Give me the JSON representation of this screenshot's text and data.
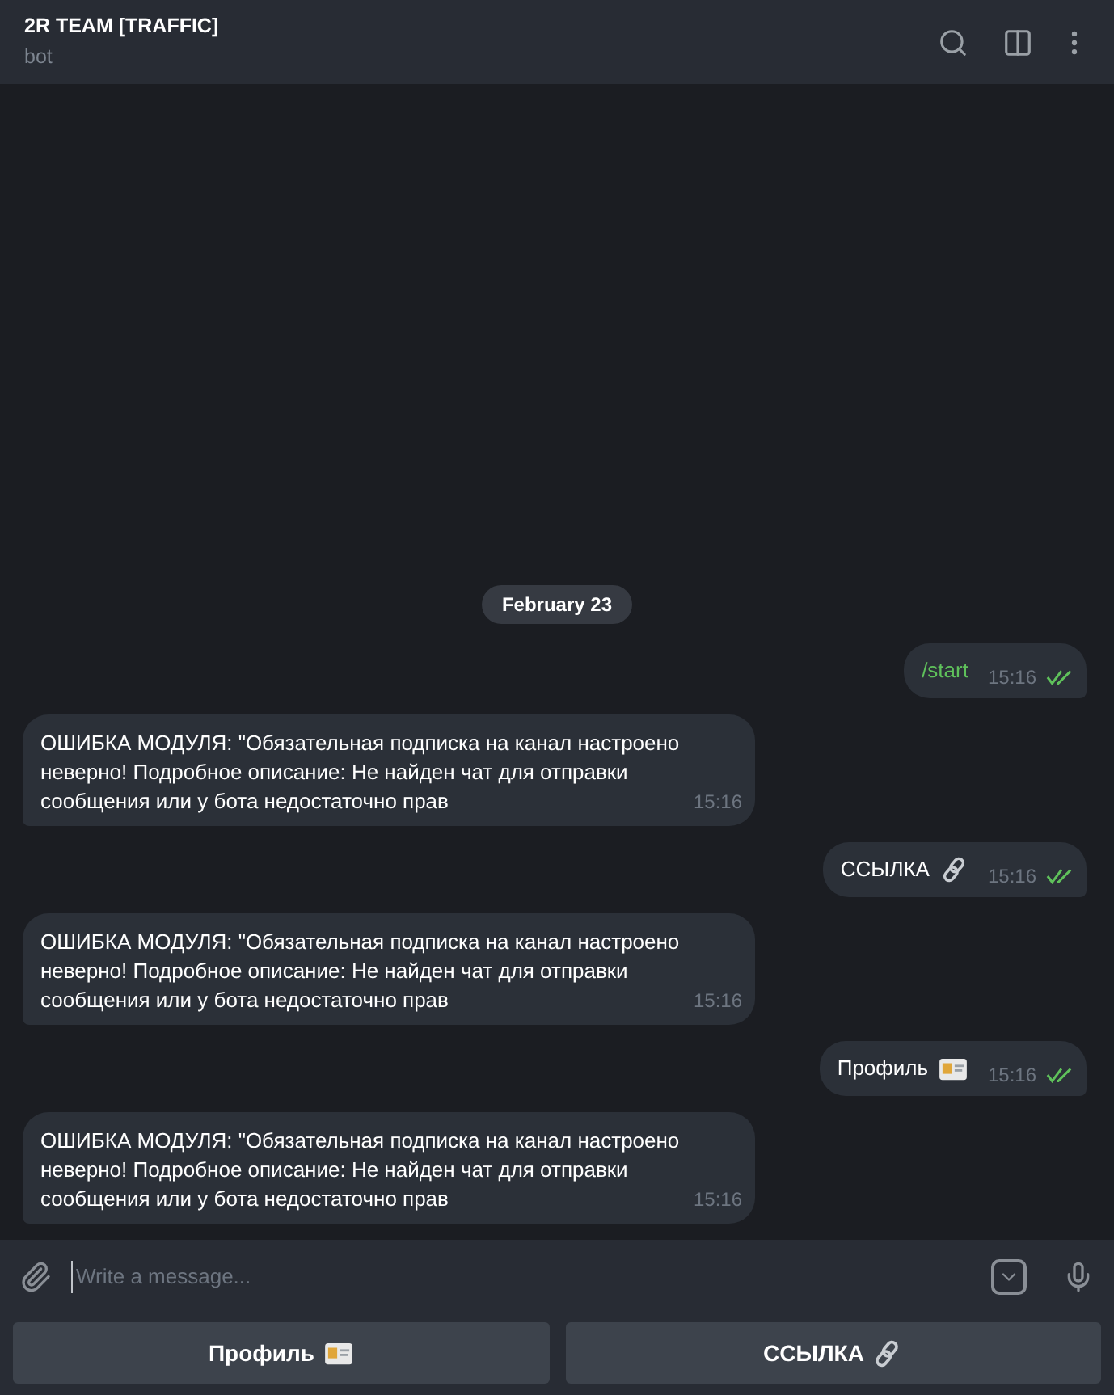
{
  "header": {
    "title": "2R TEAM [TRAFFIC]",
    "subtitle": "bot"
  },
  "date_badge": "February 23",
  "messages": [
    {
      "kind": "command",
      "text": "/start",
      "time": "15:16",
      "read": true
    },
    {
      "kind": "incoming",
      "text": "ОШИБКА МОДУЛЯ: \"Обязательная подписка на канал настроено неверно! Подробное описание: Не найден чат для отправки сообщения или у бота недостаточно прав",
      "time": "15:16"
    },
    {
      "kind": "link",
      "text": "ССЫЛКА",
      "time": "15:16",
      "read": true
    },
    {
      "kind": "incoming",
      "text": "ОШИБКА МОДУЛЯ: \"Обязательная подписка на канал настроено неверно! Подробное описание: Не найден чат для отправки сообщения или у бота недостаточно прав",
      "time": "15:16"
    },
    {
      "kind": "card",
      "text": "Профиль",
      "time": "15:16",
      "read": true
    },
    {
      "kind": "incoming",
      "text": "ОШИБКА МОДУЛЯ: \"Обязательная подписка на канал настроено неверно! Подробное описание: Не найден чат для отправки сообщения или у бота недостаточно прав",
      "time": "15:16"
    }
  ],
  "composer": {
    "placeholder": "Write a message..."
  },
  "keyboard": [
    {
      "label": "Профиль",
      "kind": "card"
    },
    {
      "label": "ССЫЛКА",
      "kind": "link"
    }
  ]
}
